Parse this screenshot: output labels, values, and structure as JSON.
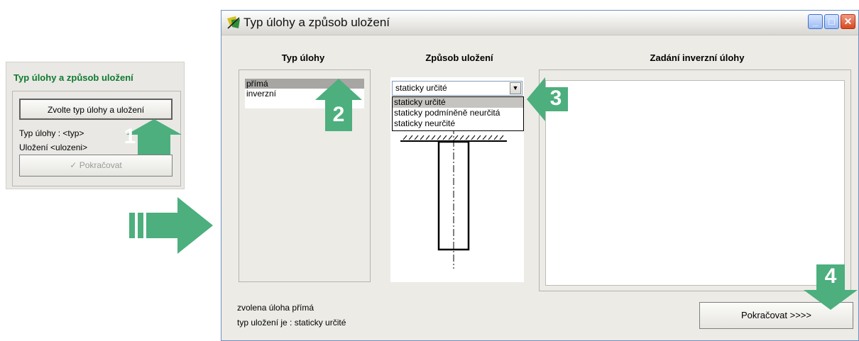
{
  "left_panel": {
    "title": "Typ úlohy a způsob uložení",
    "choose_button": "Zvolte typ úlohy a uložení",
    "type_label": "Typ úlohy : <typ>",
    "ulozeni_label": "Uložení <ulozeni>",
    "continue_button": "Pokračovat",
    "continue_icon": "checkmark-icon"
  },
  "dialog": {
    "title": "Typ úlohy a způsob uložení",
    "window_buttons": [
      "minimize",
      "maximize",
      "close"
    ],
    "columns": {
      "type": "Typ úlohy",
      "support": "Způsob uložení",
      "inverse": "Zadání inverzní úlohy"
    },
    "type_list": {
      "items": [
        "přímá",
        "inverzní"
      ],
      "selected": "přímá"
    },
    "support_select": {
      "value": "staticky určité",
      "options": [
        "staticky určité",
        "staticky podmíněně neurčitá",
        "staticky neurčité"
      ]
    },
    "status": {
      "line1": "zvolena úloha přímá",
      "line2": "typ uložení je : staticky určité"
    },
    "continue_button": "Pokračovat  >>>>"
  },
  "step_markers": [
    "1",
    "2",
    "3",
    "4"
  ],
  "colors": {
    "marker_green": "#4caf7d",
    "panel_title_green": "#0f7a2f",
    "dialog_bg": "#ecebe6"
  }
}
